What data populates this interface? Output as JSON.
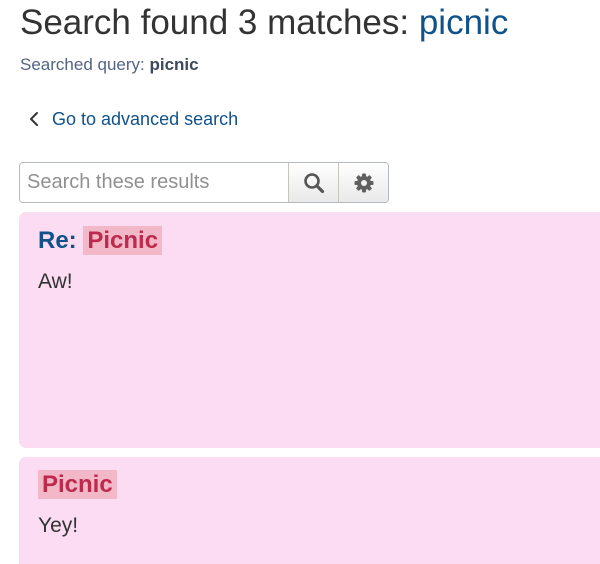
{
  "header": {
    "title_prefix": "Search found 3 matches: ",
    "title_query": "picnic",
    "subtitle_prefix": "Searched query: ",
    "subtitle_query": "picnic"
  },
  "nav": {
    "back_label": "Go to advanced search",
    "back_icon": "chevron-left-icon"
  },
  "search": {
    "placeholder": "Search these results",
    "value": "",
    "search_icon": "search-icon",
    "settings_icon": "gear-icon"
  },
  "results": [
    {
      "prefix": "Re: ",
      "title": "Picnic",
      "body": "Aw!"
    },
    {
      "prefix": "",
      "title": "Picnic",
      "body": "Yey!"
    }
  ],
  "colors": {
    "link": "#105289",
    "post_background": "#fcdcf2",
    "highlight_background": "#f3b8c8",
    "highlight_text": "#bc2a4d"
  }
}
